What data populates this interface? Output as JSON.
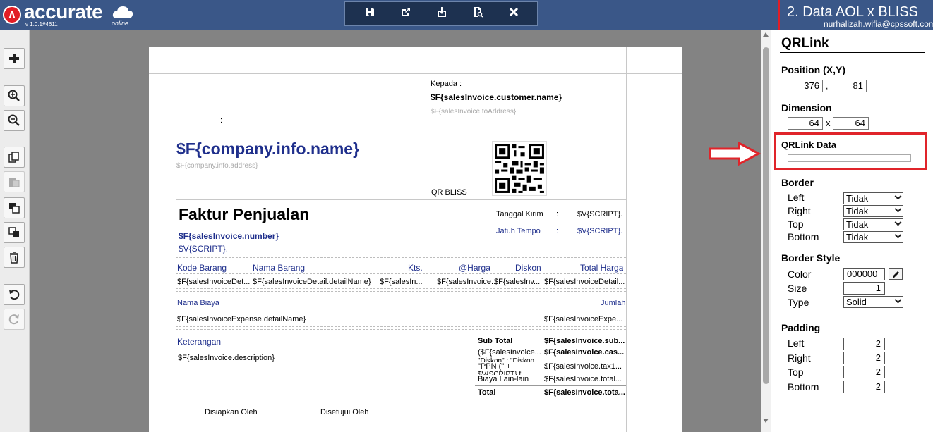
{
  "app": {
    "brand": "accurate",
    "version": "v 1.0.1#4611",
    "online": "online",
    "title": "2. Data AOL x BLISS",
    "user": "nurhalizah.wifia@cpssoft.com"
  },
  "toolbar": {
    "save": "save-icon",
    "export": "export-icon",
    "import": "import-icon",
    "preview": "preview-icon",
    "close": "close-icon"
  },
  "colors": {
    "header": "#3a5788",
    "toolbar": "#1d3150",
    "canvas": "#838383",
    "highlight": "#e0242a",
    "blue_text": "#1f2f8c"
  },
  "doc": {
    "kepada": "Kepada :",
    "customer_name": "$F{salesInvoice.customer.name}",
    "to_address": "$F{salesInvoice.toAddress}",
    "colon": ":",
    "company_name": "$F{company.info.name}",
    "company_address": "$F{company.info.address}",
    "qr_label": "QR BLISS",
    "title": "Faktur Penjualan",
    "tanggal_kirim": "Tanggal Kirim",
    "jatuh_tempo": "Jatuh Tempo",
    "sep1": ":",
    "sep2": ":",
    "script1": "$V{SCRIPT}.",
    "script2": "$V{SCRIPT}.",
    "invoice_number": "$F{salesInvoice.number}",
    "script3": "$V{SCRIPT}.",
    "columns": [
      "Kode Barang",
      "Nama Barang",
      "Kts.",
      "@Harga",
      "Diskon",
      "Total Harga"
    ],
    "detail_row": [
      "$F{salesInvoiceDet...",
      "$F{salesInvoiceDetail.detailName}",
      "$F{salesIn...",
      "$F{salesInvoice...",
      "$F{salesInv...",
      "$F{salesInvoiceDetail..."
    ],
    "nama_biaya": "Nama Biaya",
    "jumlah": "Jumlah",
    "expense_name": "$F{salesInvoiceExpense.detailName}",
    "expense_amount": "$F{salesInvoiceExpe...",
    "keterangan": "Keterangan",
    "description": "$F{salesInvoice.description}",
    "sub_total_label": "Sub Total",
    "sub_total_val": "$F{salesInvoice.sub...",
    "discount_label": "($F{salesInvoice...",
    "discount_label2": "\"Diskon\" : \"Diskon",
    "discount_val": "$F{salesInvoice.cas...",
    "ppn_label": "\"PPN (\" +",
    "ppn_label2": "$V{SCRIPT}.f...",
    "ppn_val": "$F{salesInvoice.tax1...",
    "biaya_label": "Biaya Lain-lain",
    "biaya_val": "$F{salesInvoice.total...",
    "total_label": "Total",
    "total_val": "$F{salesInvoice.tota...",
    "disiapkan": "Disiapkan Oleh",
    "disetujui": "Disetujui Oleh"
  },
  "panel": {
    "title": "QRLink",
    "position_label": "Position (X,Y)",
    "pos_x": "376",
    "pos_comma": ",",
    "pos_y": "81",
    "dimension_label": "Dimension",
    "dim_w": "64",
    "dim_x": "x",
    "dim_h": "64",
    "qrdata_label": "QRLink Data",
    "qrdata_value": "",
    "border_label": "Border",
    "border_left": "Left",
    "border_right": "Right",
    "border_top": "Top",
    "border_bottom": "Bottom",
    "border_left_val": "Tidak",
    "border_right_val": "Tidak",
    "border_top_val": "Tidak",
    "border_bottom_val": "Tidak",
    "style_label": "Border Style",
    "color_label": "Color",
    "color_val": "000000",
    "size_label": "Size",
    "size_val": "1",
    "type_label": "Type",
    "type_val": "Solid",
    "padding_label": "Padding",
    "pad_left": "Left",
    "pad_right": "Right",
    "pad_top": "Top",
    "pad_bottom": "Bottom",
    "pad_left_val": "2",
    "pad_right_val": "2",
    "pad_top_val": "2",
    "pad_bottom_val": "2"
  }
}
